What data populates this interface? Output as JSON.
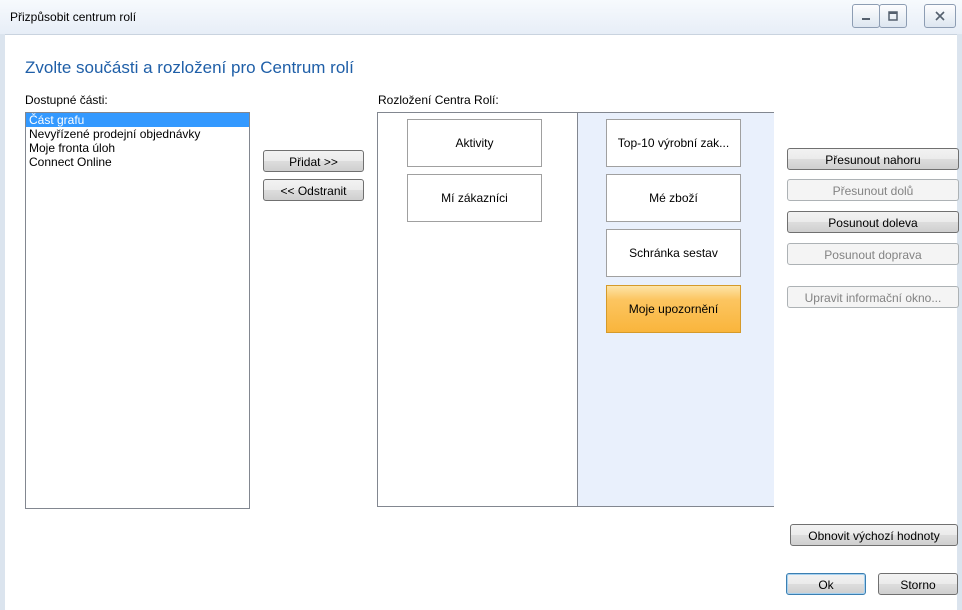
{
  "window": {
    "title": "Přizpůsobit centrum rolí"
  },
  "heading": "Zvolte součásti a rozložení pro Centrum rolí",
  "available": {
    "label": "Dostupné části:",
    "items": [
      "Část grafu",
      "Nevyřízené prodejní objednávky",
      "Moje fronta úloh",
      "Connect Online"
    ],
    "selected_index": 0
  },
  "middle_buttons": {
    "add": "Přidat >>",
    "remove": "<< Odstranit"
  },
  "layout": {
    "label": "Rozložení Centra Rolí:",
    "column1": [
      "Aktivity",
      "Mí zákazníci"
    ],
    "column2": [
      "Top-10 výrobní zak...",
      "Mé zboží",
      "Schránka sestav",
      "Moje upozornění"
    ],
    "active_part": "Moje upozornění"
  },
  "right_buttons": {
    "move_up": "Přesunout nahoru",
    "move_down": "Přesunout dolů",
    "move_left": "Posunout doleva",
    "move_right": "Posunout doprava",
    "edit_info": "Upravit informační okno..."
  },
  "bottom_buttons": {
    "reset": "Obnovit výchozí hodnoty",
    "ok": "Ok",
    "cancel": "Storno"
  },
  "colors": {
    "heading": "#1f5fa8",
    "selection": "#3399ff",
    "column2_bg": "#e9f0fc",
    "active_part": "#f9b53c"
  }
}
